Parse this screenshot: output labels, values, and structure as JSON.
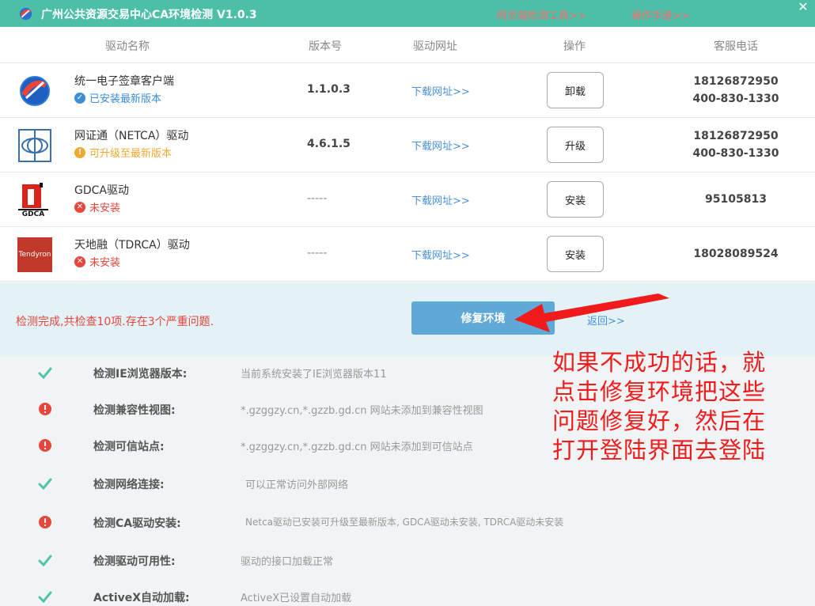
{
  "window": {
    "title": "广州公共资源交易中心CA环境检测 V1.0.3",
    "link_web_tool": "网页端检测工具>>",
    "link_manual": "操作手册>>",
    "close_glyph": "✕"
  },
  "table": {
    "headers": [
      "驱动名称",
      "版本号",
      "驱动网址",
      "操作",
      "客服电话"
    ],
    "rows": [
      {
        "name": "统一电子签章客户端",
        "status": "已安装最新版本",
        "status_color": "#3b8ed8",
        "status_glyph": "✓",
        "version": "1.1.0.3",
        "download": "下载网址>>",
        "action": "卸载",
        "phone1": "18126872950",
        "phone2": "400-830-1330"
      },
      {
        "name": "网证通（NETCA）驱动",
        "status": "可升级至最新版本",
        "status_color": "#f0a92e",
        "status_glyph": "!",
        "version": "4.6.1.5",
        "download": "下载网址>>",
        "action": "升级",
        "phone1": "18126872950",
        "phone2": "400-830-1330"
      },
      {
        "name": "GDCA驱动",
        "status": "未安装",
        "status_color": "#e8453c",
        "status_glyph": "✕",
        "version": "-----",
        "download": "下载网址>>",
        "action": "安装",
        "phone1": "95105813",
        "phone2": ""
      },
      {
        "name": "天地融（TDRCA）驱动",
        "status": "未安装",
        "status_color": "#e8453c",
        "status_glyph": "✕",
        "version": "-----",
        "download": "下载网址>>",
        "action": "安装",
        "phone1": "18028089524",
        "phone2": ""
      }
    ],
    "logo_texts": {
      "gdca": "GDCA",
      "tendyron": "Tendyron"
    }
  },
  "result": {
    "message": "检测完成,共检查10项.存在3个严重问题.",
    "fix_button": "修复环境",
    "back_link": "返回>>"
  },
  "checks": [
    {
      "label": "检测IE浏览器版本:",
      "value": "当前系统安装了IE浏览器版本11",
      "ok": true
    },
    {
      "label": "检测兼容性视图:",
      "value": "*.gzggzy.cn,*.gzzb.gd.cn 网站未添加到兼容性视图",
      "ok": false
    },
    {
      "label": "检测可信站点:",
      "value": "*.gzggzy.cn,*.gzzb.gd.cn 网站未添加到可信站点",
      "ok": false
    },
    {
      "label": "检测网络连接:",
      "value": "可以正常访问外部网络",
      "ok": true
    },
    {
      "label": "检测CA驱动安装:",
      "value": "Netca驱动已安装可升级至最新版本, GDCA驱动未安装, TDRCA驱动未安装",
      "ok": false
    },
    {
      "label": "检测驱动可用性:",
      "value": "驱动的接口加载正常",
      "ok": true
    },
    {
      "label": "ActiveX自动加载:",
      "value": "ActiveX已设置自动加载",
      "ok": true
    }
  ],
  "annotation": {
    "lines": [
      "如果不成功的话，就",
      "点击修复环境把这些",
      "问题修复好，然后在",
      "打开登陆界面去登陆"
    ]
  },
  "colors": {
    "ok": "#52c2a8",
    "error": "#e8453c",
    "accent": "#4cbfa8"
  }
}
